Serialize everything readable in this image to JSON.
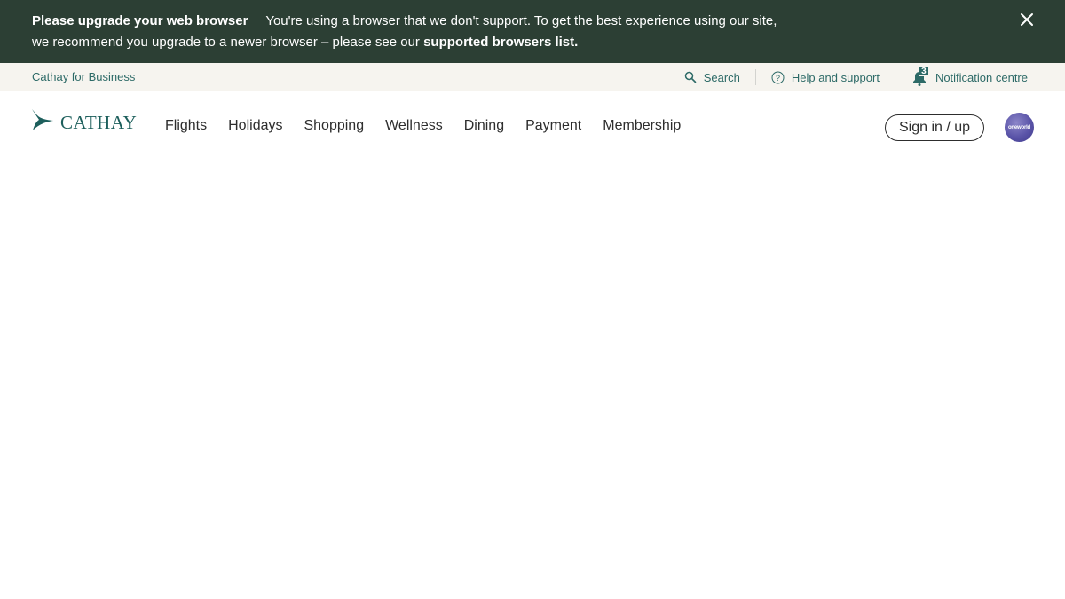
{
  "banner": {
    "title": "Please upgrade your web browser",
    "message": "You're using a browser that we don't support. To get the best experience using our site, we recommend you upgrade to a newer browser – please see our",
    "link_text": "supported browsers list.",
    "close_icon": "close-icon",
    "background_color": "#2c3f34"
  },
  "utility": {
    "business_link": "Cathay for Business",
    "search_label": "Search",
    "help_label": "Help and support",
    "notification_label": "Notification centre",
    "notification_count": "3",
    "accent_color": "#2d6a67",
    "background_color": "#f6f4ef"
  },
  "nav": {
    "logo_text": "CATHAY",
    "items": [
      {
        "label": "Flights"
      },
      {
        "label": "Holidays"
      },
      {
        "label": "Shopping"
      },
      {
        "label": "Wellness"
      },
      {
        "label": "Dining"
      },
      {
        "label": "Payment"
      },
      {
        "label": "Membership"
      }
    ],
    "signin_label": "Sign in / up",
    "avatar_text": "oneworld"
  },
  "icons": {
    "search": "search-icon",
    "help": "help-icon",
    "notification": "bell-icon",
    "logo": "cathay-brushwing-logo"
  }
}
